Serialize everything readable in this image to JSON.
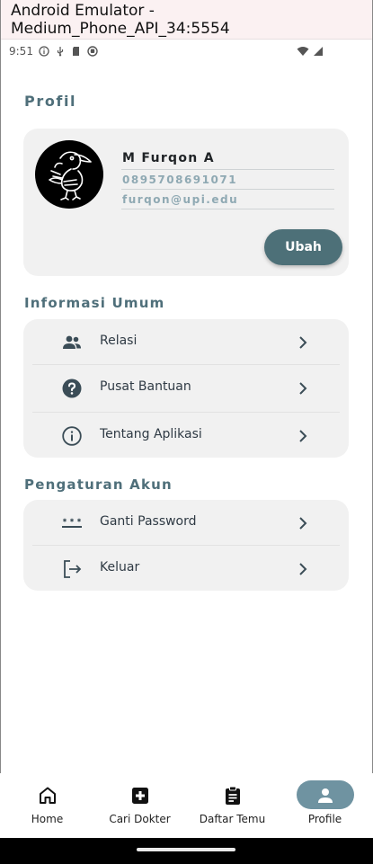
{
  "window": {
    "title": "Android Emulator - Medium_Phone_API_34:5554"
  },
  "status_bar": {
    "time": "9:51"
  },
  "page": {
    "title": "Profil"
  },
  "profile": {
    "name": "M Furqon A",
    "phone": "0895708691071",
    "email": "furqon@upi.edu",
    "edit_label": "Ubah"
  },
  "info_section": {
    "title": "Informasi Umum",
    "items": [
      {
        "label": "Relasi",
        "icon": "people-icon"
      },
      {
        "label": "Pusat Bantuan",
        "icon": "help-icon"
      },
      {
        "label": "Tentang Aplikasi",
        "icon": "info-icon"
      }
    ]
  },
  "account_section": {
    "title": "Pengaturan Akun",
    "items": [
      {
        "label": "Ganti Password",
        "icon": "password-icon"
      },
      {
        "label": "Keluar",
        "icon": "logout-icon"
      }
    ]
  },
  "bottom_nav": {
    "items": [
      {
        "label": "Home",
        "icon": "home-icon"
      },
      {
        "label": "Cari Dokter",
        "icon": "medical-cross-icon"
      },
      {
        "label": "Daftar Temu",
        "icon": "clipboard-icon"
      },
      {
        "label": "Profile",
        "icon": "person-icon",
        "active": true
      }
    ]
  },
  "colors": {
    "accent": "#4d7078",
    "section_title": "#4f6f7a",
    "card_bg": "#f1f1f1",
    "active_pill": "#6f93a1"
  }
}
